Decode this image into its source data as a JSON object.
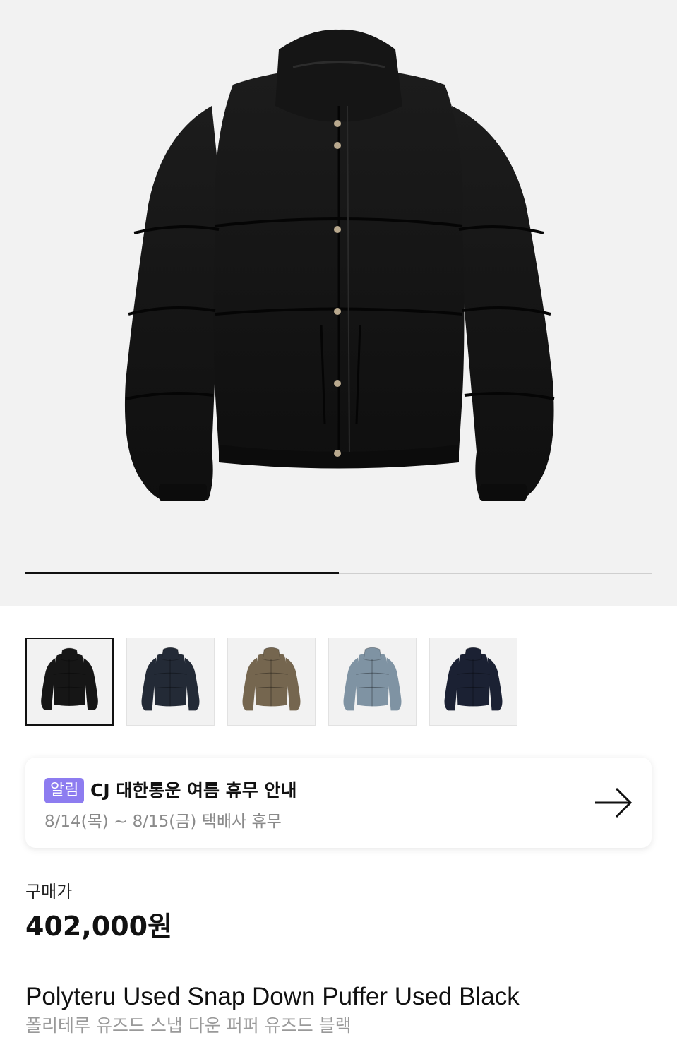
{
  "gallery": {
    "main_image": "black-puffer-jacket",
    "progress_fraction": 0.5,
    "thumbnails": [
      {
        "name": "thumb-black",
        "color": "#161616",
        "active": true
      },
      {
        "name": "thumb-charcoal-navy",
        "color": "#232a36",
        "active": false
      },
      {
        "name": "thumb-brown",
        "color": "#75664f",
        "active": false
      },
      {
        "name": "thumb-grey-blue",
        "color": "#7f93a3",
        "active": false
      },
      {
        "name": "thumb-navy",
        "color": "#1b2133",
        "active": false
      }
    ]
  },
  "notice": {
    "badge": "알림",
    "title": "CJ 대한통운 여름 휴무 안내",
    "subtitle": "8/14(목) ~ 8/15(금) 택배사 휴무",
    "icon": "arrow-right-icon",
    "badge_color": "#8d7cf0"
  },
  "price": {
    "label": "구매가",
    "value": "402,000원"
  },
  "product": {
    "name_en": "Polyteru Used Snap Down Puffer Used Black",
    "name_ko": "폴리테루 유즈드 스냅 다운 퍼퍼 유즈드 블랙"
  }
}
